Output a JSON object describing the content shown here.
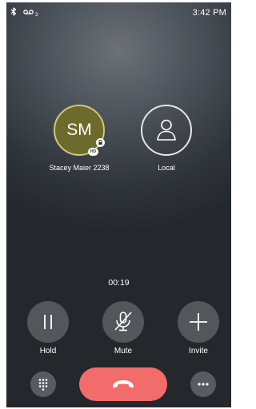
{
  "status_bar": {
    "time": "3:42 PM",
    "voicemail_count": "3",
    "icons": [
      "bluetooth-icon",
      "voicemail-icon"
    ]
  },
  "participants": [
    {
      "initials": "SM",
      "name": "Stacey Maier 2238",
      "avatar_color": "#6d6b2b",
      "badges": [
        "lock-icon",
        "HD"
      ]
    },
    {
      "initials": "",
      "name": "Local",
      "icon": "person-icon"
    }
  ],
  "call": {
    "timer": "00:19"
  },
  "controls": {
    "hold_label": "Hold",
    "mute_label": "Mute",
    "invite_label": "Invite",
    "hold_icon": "pause-icon",
    "mute_icon": "microphone-muted-icon",
    "invite_icon": "plus-icon"
  },
  "bottom_bar": {
    "keypad_icon": "dialpad-icon",
    "end_call_icon": "hang-up-icon",
    "end_call_color": "#f26c6c",
    "more_icon": "more-horizontal-icon"
  }
}
